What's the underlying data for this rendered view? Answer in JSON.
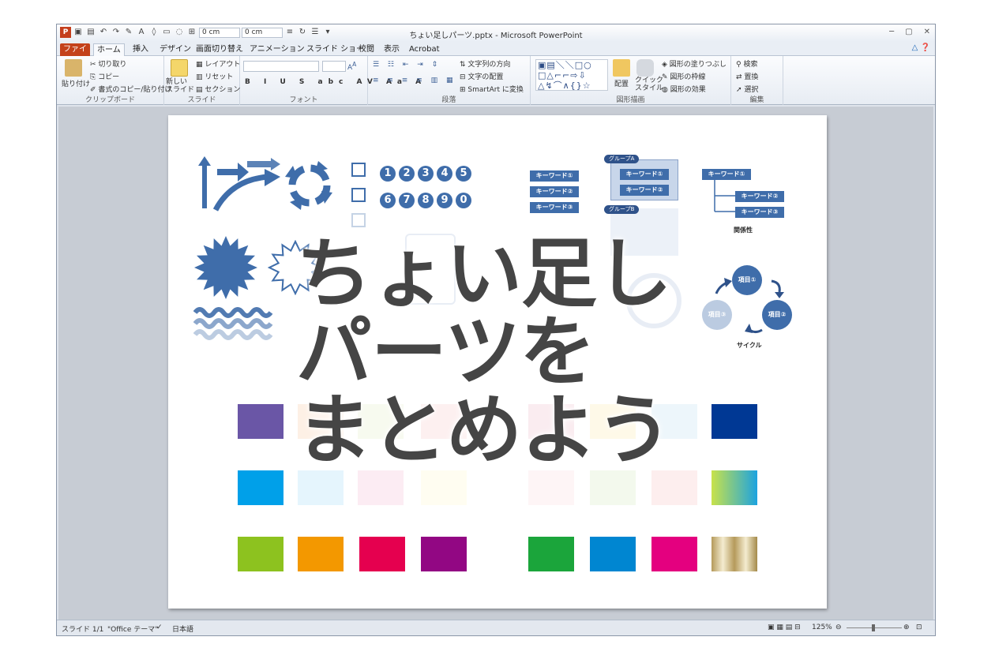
{
  "window": {
    "title": "ちょい足しパーツ.pptx - Microsoft PowerPoint",
    "field_values": [
      "0 cm",
      "0 cm"
    ]
  },
  "tabs": [
    {
      "label": "ファイル"
    },
    {
      "label": "ホーム"
    },
    {
      "label": "挿入"
    },
    {
      "label": "デザイン"
    },
    {
      "label": "画面切り替え"
    },
    {
      "label": "アニメーション"
    },
    {
      "label": "スライド ショー"
    },
    {
      "label": "校閲"
    },
    {
      "label": "表示"
    },
    {
      "label": "Acrobat"
    }
  ],
  "ribbon": {
    "clipboard": {
      "paste": "貼り付け",
      "cut": "切り取り",
      "copy": "コピー",
      "format_painter": "書式のコピー/貼り付け",
      "label": "クリップボード"
    },
    "slides": {
      "new_slide": "新しい\nスライド",
      "layout": "レイアウト",
      "reset": "リセット",
      "section": "セクション",
      "label": "スライド"
    },
    "font": {
      "label": "フォント"
    },
    "paragraph": {
      "text_direction": "文字列の方向",
      "align_text": "文字の配置",
      "smartart": "SmartArt に変換",
      "label": "段落"
    },
    "drawing": {
      "arrange": "配置",
      "quick_styles": "クイック\nスタイル",
      "shape_fill": "図形の塗りつぶし",
      "shape_outline": "図形の枠線",
      "shape_effects": "図形の効果",
      "label": "図形描画"
    },
    "editing": {
      "find": "検索",
      "replace": "置換",
      "select": "選択",
      "label": "編集"
    }
  },
  "slide": {
    "title_lines": [
      "ちょい足し",
      "パーツを",
      "まとめよう"
    ],
    "numbers_row1": [
      "1",
      "2",
      "3",
      "4",
      "5"
    ],
    "numbers_row2": [
      "6",
      "7",
      "8",
      "9",
      "0"
    ],
    "keyword": "キーワード①",
    "keyword2": "キーワード②",
    "keyword3": "キーワード③",
    "group_a": "グループA",
    "group_b": "グループB",
    "relation_caption": "関係性",
    "cycle_items": [
      "項目①",
      "項目②",
      "項目③"
    ],
    "cycle_caption": "サイクル",
    "swatch_colors_row3": [
      "#8dc21f",
      "#f39800",
      "#e5004f",
      "#920783",
      "#1ba53b",
      "#0086d1",
      "#e4007f"
    ],
    "swatch_colors_left_top": "#6a56a6",
    "swatch_colors_left_mid": "#00a0e9",
    "swatch_colors_right_top": "#003894"
  },
  "status": {
    "slide": "スライド 1/1",
    "theme": "\"Office テーマ\"",
    "language": "日本語",
    "zoom": "125%"
  },
  "colors": {
    "accent": "#3f6daa",
    "file_tab": "#c4421b"
  }
}
